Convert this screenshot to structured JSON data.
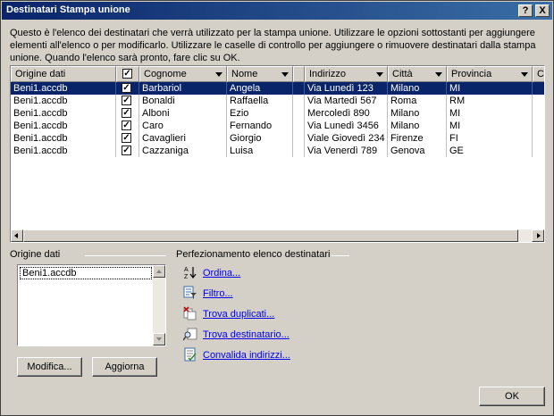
{
  "window": {
    "title": "Destinatari Stampa unione"
  },
  "description": "Questo è l'elenco dei destinatari che verrà utilizzato per la stampa unione. Utilizzare le opzioni sottostanti per aggiungere elementi all'elenco o per modificarlo. Utilizzare le caselle di controllo per aggiungere o rimuovere destinatari dalla stampa unione. Quando l'elenco sarà pronto, fare clic su OK.",
  "table": {
    "headers": [
      "Origine dati",
      "",
      "Cognome",
      "Nome",
      "",
      "Indirizzo",
      "Città",
      "Provincia",
      "Co"
    ],
    "rows": [
      {
        "source": "Beni1.accdb",
        "checked": "✓",
        "cognome": "Barbariol",
        "nome": "Angela",
        "indirizzo": "Via Lunedì 123",
        "citta": "Milano",
        "provincia": "MI"
      },
      {
        "source": "Beni1.accdb",
        "checked": "✓",
        "cognome": "Bonaldi",
        "nome": "Raffaella",
        "indirizzo": "Via Martedì 567",
        "citta": "Roma",
        "provincia": "RM"
      },
      {
        "source": "Beni1.accdb",
        "checked": "✓",
        "cognome": "Alboni",
        "nome": "Ezio",
        "indirizzo": "Mercoledì 890",
        "citta": "Milano",
        "provincia": "MI"
      },
      {
        "source": "Beni1.accdb",
        "checked": "✓",
        "cognome": "Caro",
        "nome": "Fernando",
        "indirizzo": "Via Lunedì 3456",
        "citta": "Milano",
        "provincia": "MI"
      },
      {
        "source": "Beni1.accdb",
        "checked": "✓",
        "cognome": "Cavaglieri",
        "nome": "Giorgio",
        "indirizzo": "Viale Giovedì 234",
        "citta": "Firenze",
        "provincia": "FI"
      },
      {
        "source": "Beni1.accdb",
        "checked": "✓",
        "cognome": "Cazzaniga",
        "nome": "Luisa",
        "indirizzo": "Via Venerdì 789",
        "citta": "Genova",
        "provincia": "GE"
      }
    ]
  },
  "source_panel": {
    "label": "Origine dati",
    "items": [
      "Beni1.accdb"
    ],
    "edit_button": "Modifica...",
    "refresh_button": "Aggiorna"
  },
  "refine_panel": {
    "label": "Perfezionamento elenco destinatari",
    "links": [
      {
        "label": "Ordina...",
        "icon": "sort-icon"
      },
      {
        "label": "Filtro...",
        "icon": "filter-icon"
      },
      {
        "label": "Trova duplicati...",
        "icon": "duplicates-icon"
      },
      {
        "label": "Trova destinatario...",
        "icon": "find-recipient-icon"
      },
      {
        "label": "Convalida indirizzi...",
        "icon": "validate-addresses-icon"
      }
    ]
  },
  "buttons": {
    "ok": "OK",
    "help": "?",
    "close": "X"
  },
  "colors": {
    "titlebar": "#0a246a",
    "selection": "#0a246a",
    "face": "#d4d0c8",
    "link": "#0000ee"
  }
}
